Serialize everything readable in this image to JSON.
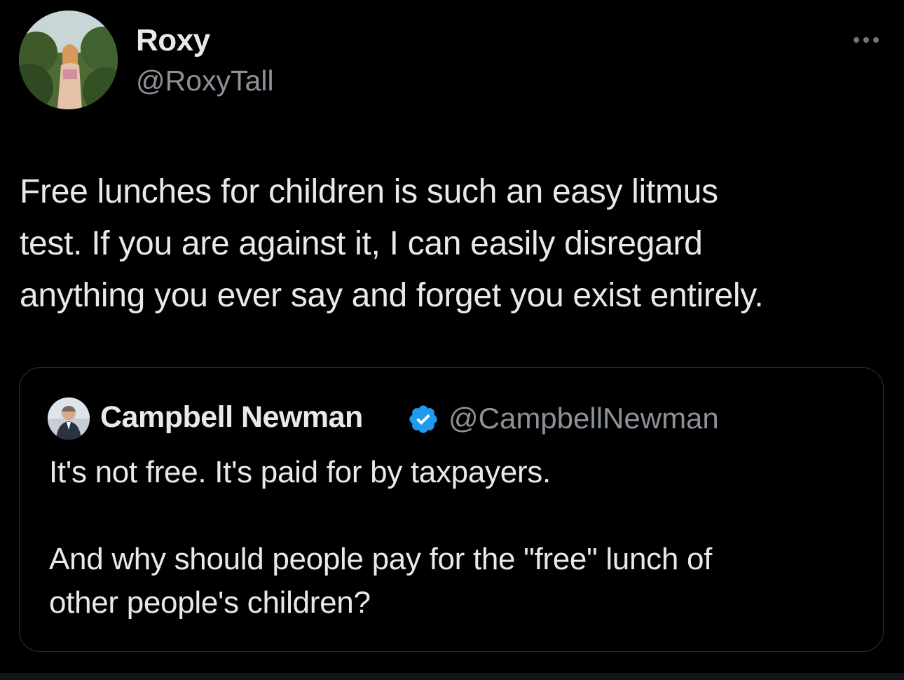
{
  "tweet": {
    "author": {
      "display_name": "Roxy",
      "handle": "@RoxyTall"
    },
    "more_icon": "more-horizontal-icon",
    "text": "Free lunches for children is such an easy litmus\ntest. If you are against it, I can easily disregard\nanything you ever say and forget you exist entirely."
  },
  "quoted_tweet": {
    "author": {
      "display_name": "Campbell Newman",
      "handle": "@CampbellNewman",
      "verified": true,
      "verified_icon": "verified-badge-icon"
    },
    "text": "It's not free.  It's paid for by taxpayers.\n\nAnd why should people pay for the \"free\" lunch of\nother people's children?"
  },
  "colors": {
    "background": "#000000",
    "primary_text": "#e7e9ea",
    "secondary_text": "#8b9197",
    "border": "#2f3336",
    "verified_blue": "#1d9bf0"
  }
}
